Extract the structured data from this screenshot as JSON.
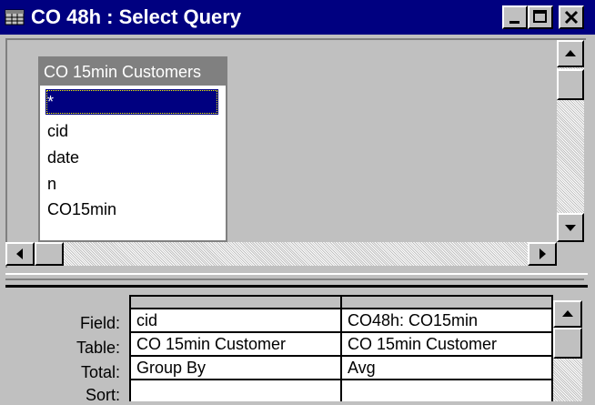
{
  "window": {
    "title": "CO 48h : Select Query",
    "icon": "query-icon",
    "controls": [
      "minimize-icon",
      "maximize-icon",
      "close-icon"
    ]
  },
  "table_box": {
    "title": "CO 15min Customers",
    "fields": [
      "*",
      "cid",
      "date",
      "n",
      "CO15min"
    ],
    "selected_index": 0
  },
  "design_grid": {
    "row_labels": [
      "Field:",
      "Table:",
      "Total:",
      "Sort:"
    ],
    "columns": [
      {
        "field": "cid",
        "table": "CO 15min Customer",
        "total": "Group By"
      },
      {
        "field": "CO48h: CO15min",
        "table": "CO 15min Customer",
        "total": "Avg"
      }
    ]
  },
  "colors": {
    "title_bar": "#000080",
    "selection": "#000080",
    "face": "#c0c0c0",
    "shadow": "#808080"
  }
}
